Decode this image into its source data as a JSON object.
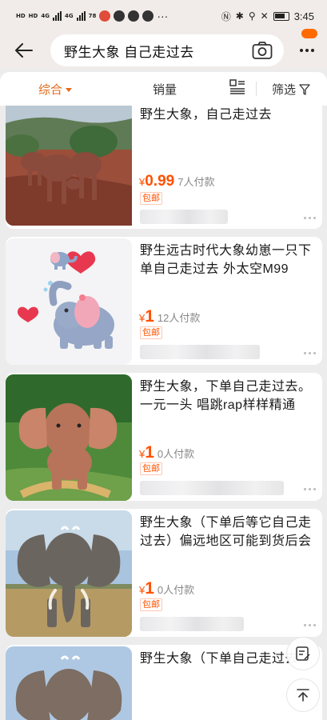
{
  "status_bar": {
    "left_chips": [
      "HD",
      "HD"
    ],
    "network_1": "4G",
    "network_2": "4G",
    "speed": "78",
    "time": "3:45"
  },
  "header": {
    "search_query": "野生大象 自己走过去"
  },
  "filter_bar": {
    "sort_label": "综合",
    "sales_label": "销量",
    "filter_label": "筛选"
  },
  "products": [
    {
      "title": "野生大象，自己走过去",
      "price_symbol": "¥",
      "price": "0.99",
      "paid": "7人付款",
      "tag": "包邮"
    },
    {
      "title": "野生远古时代大象幼崽一只下单自己走过去 外太空M99",
      "price_symbol": "¥",
      "price": "1",
      "paid": "12人付款",
      "tag": "包邮"
    },
    {
      "title": "野生大象，下单自己走过去。一元一头 唱跳rap样样精通",
      "price_symbol": "¥",
      "price": "1",
      "paid": "0人付款",
      "tag": "包邮"
    },
    {
      "title": "野生大象（下单后等它自己走过去）偏远地区可能到货后会",
      "price_symbol": "¥",
      "price": "1",
      "paid": "0人付款",
      "tag": "包邮"
    },
    {
      "title": "野生大象（下单自己走过去"
    }
  ],
  "colors": {
    "accent": "#e46a1a",
    "price": "#ff5000",
    "header_bg": "#f1ece9",
    "page_bg": "#ececec"
  },
  "icons": [
    "back-arrow-icon",
    "camera-icon",
    "more-icon",
    "list-layout-icon",
    "filter-funnel-icon",
    "edit-note-icon",
    "scroll-top-icon"
  ]
}
